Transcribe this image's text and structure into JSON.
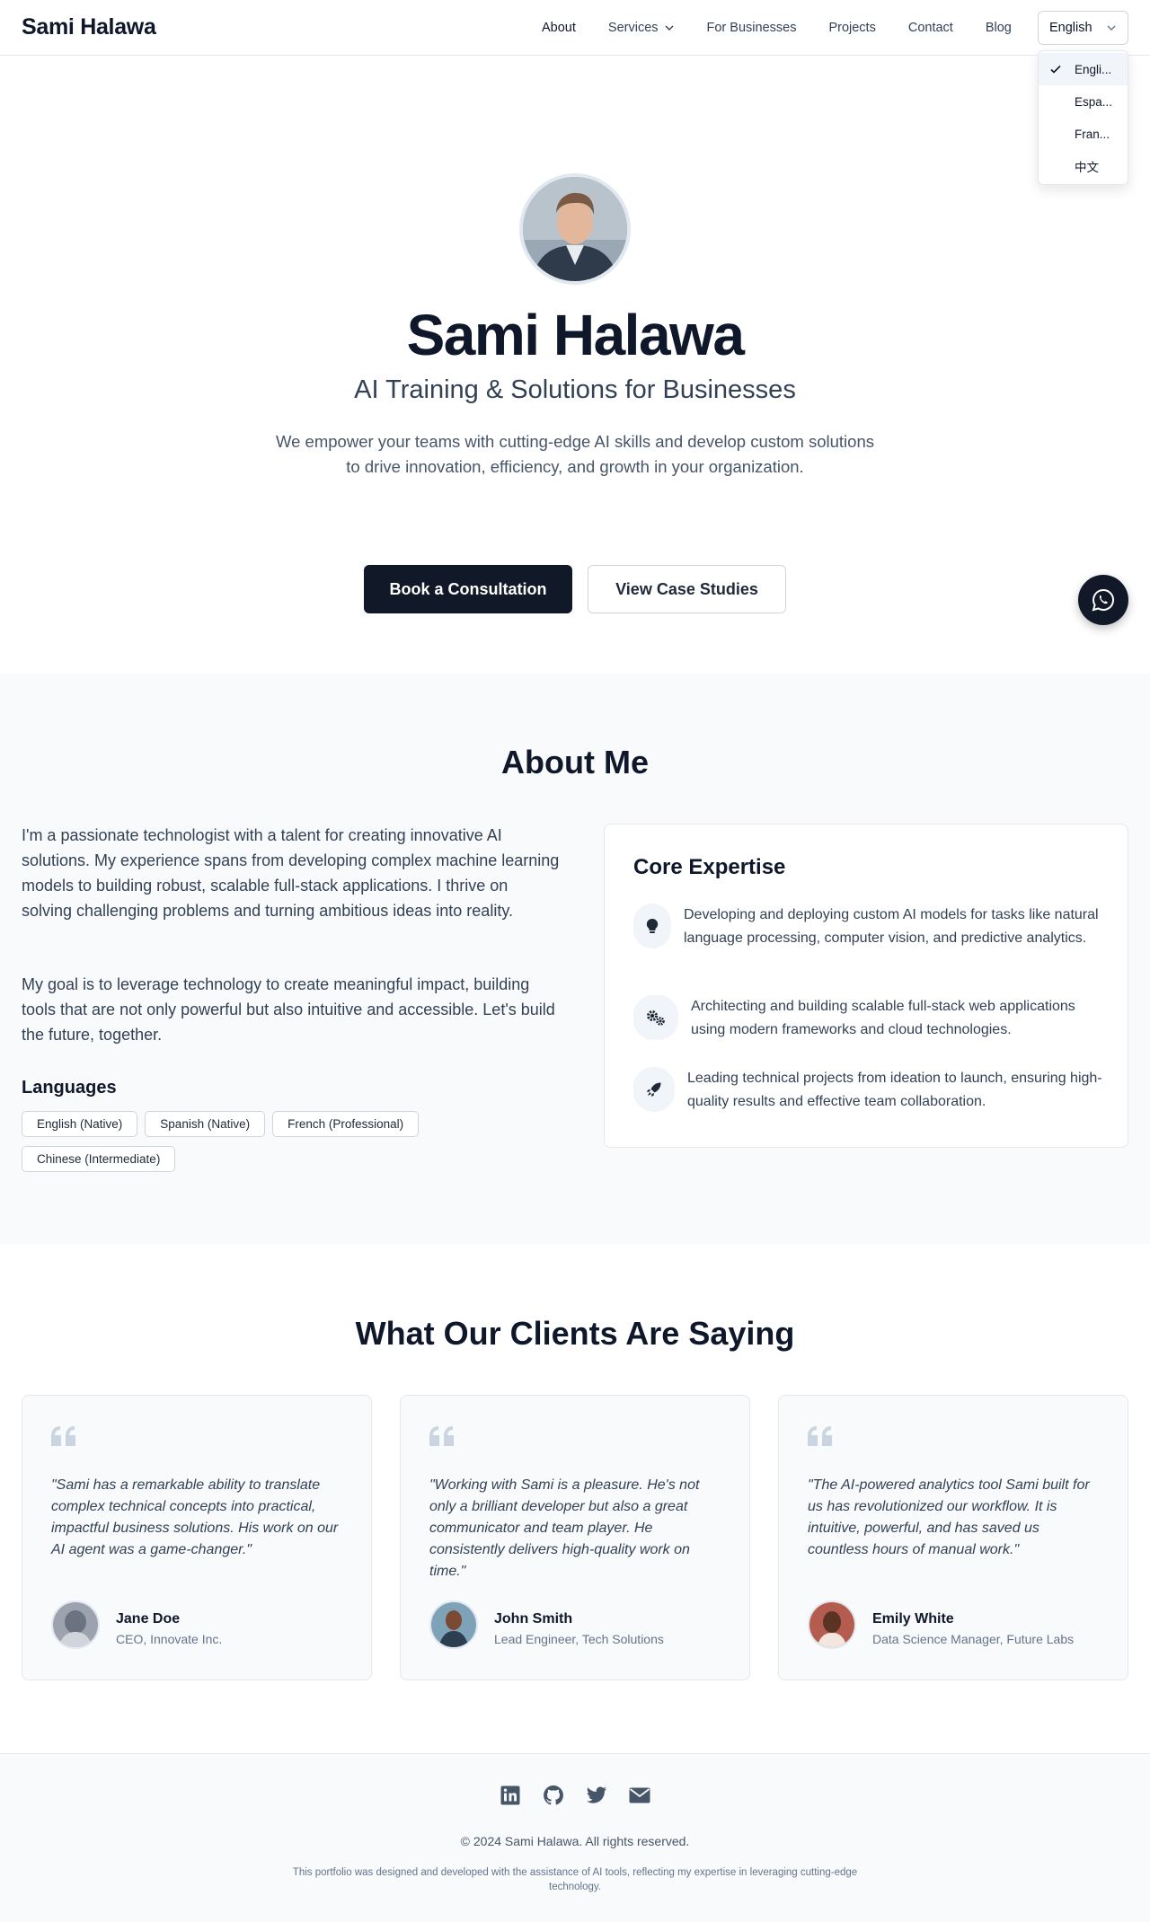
{
  "header": {
    "brand": "Sami Halawa",
    "nav": [
      {
        "label": "About"
      },
      {
        "label": "Services"
      },
      {
        "label": "For Businesses"
      },
      {
        "label": "Projects"
      },
      {
        "label": "Contact"
      },
      {
        "label": "Blog"
      }
    ],
    "language": {
      "selected": "English",
      "options": [
        "Engli...",
        "Espa...",
        "Fran...",
        "中文"
      ]
    }
  },
  "hero": {
    "name": "Sami Halawa",
    "subtitle": "AI Training & Solutions for Businesses",
    "description": "We empower your teams with cutting-edge AI skills and develop custom solutions to drive innovation, efficiency, and growth in your organization.",
    "primary_button": "Book a Consultation",
    "secondary_button": "View Case Studies"
  },
  "about": {
    "title": "About Me",
    "paragraph1": "I'm a passionate technologist with a talent for creating innovative AI solutions. My experience spans from developing complex machine learning models to building robust, scalable full-stack applications. I thrive on solving challenging problems and turning ambitious ideas into reality.",
    "paragraph2": "My goal is to leverage technology to create meaningful impact, building tools that are not only powerful but also intuitive and accessible. Let's build the future, together.",
    "languages_title": "Languages",
    "languages": [
      "English (Native)",
      "Spanish (Native)",
      "French (Professional)",
      "Chinese (Intermediate)"
    ],
    "expertise": {
      "title": "Core Expertise",
      "items": [
        {
          "icon": "lightbulb-icon",
          "text": "Developing and deploying custom AI models for tasks like natural language processing, computer vision, and predictive analytics."
        },
        {
          "icon": "gears-icon",
          "text": "Architecting and building scalable full-stack web applications using modern frameworks and cloud technologies."
        },
        {
          "icon": "rocket-icon",
          "text": "Leading technical projects from ideation to launch, ensuring high-quality results and effective team collaboration."
        }
      ]
    }
  },
  "testimonials": {
    "title": "What Our Clients Are Saying",
    "items": [
      {
        "quote": "\"Sami has a remarkable ability to translate complex technical concepts into practical, impactful business solutions. His work on our AI agent was a game-changer.\"",
        "name": "Jane Doe",
        "role": "CEO, Innovate Inc."
      },
      {
        "quote": "\"Working with Sami is a pleasure. He's not only a brilliant developer but also a great communicator and team player. He consistently delivers high-quality work on time.\"",
        "name": "John Smith",
        "role": "Lead Engineer, Tech Solutions"
      },
      {
        "quote": "\"The AI-powered analytics tool Sami built for us has revolutionized our workflow. It is intuitive, powerful, and has saved us countless hours of manual work.\"",
        "name": "Emily White",
        "role": "Data Science Manager, Future Labs"
      }
    ]
  },
  "footer": {
    "socials": [
      "linkedin-icon",
      "github-icon",
      "twitter-icon",
      "email-icon"
    ],
    "copyright": "© 2024 Sami Halawa. All rights reserved.",
    "note": "This portfolio was designed and developed with the assistance of AI tools, reflecting my expertise in leveraging cutting-edge technology."
  },
  "colors": {
    "primary": "#111827",
    "text": "#0f172a",
    "muted": "#475569",
    "section_bg": "#f8fafc"
  }
}
